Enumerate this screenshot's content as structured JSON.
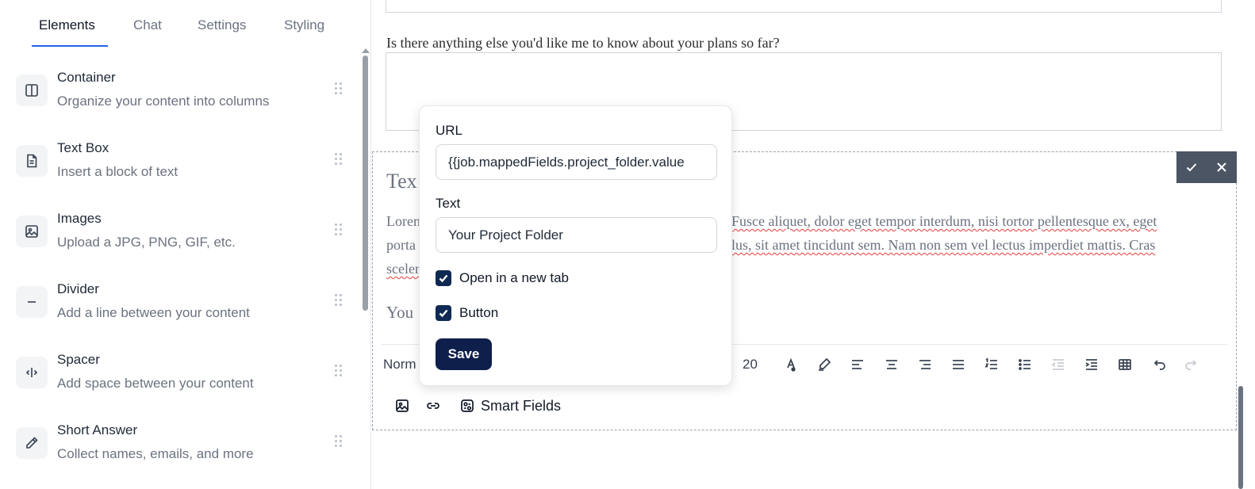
{
  "tabs": [
    {
      "label": "Elements",
      "active": true
    },
    {
      "label": "Chat",
      "active": false
    },
    {
      "label": "Settings",
      "active": false
    },
    {
      "label": "Styling",
      "active": false
    }
  ],
  "elements": [
    {
      "title": "Container",
      "desc": "Organize your content into columns",
      "icon": "columns-icon"
    },
    {
      "title": "Text Box",
      "desc": "Insert a block of text",
      "icon": "document-icon"
    },
    {
      "title": "Images",
      "desc": "Upload a JPG, PNG, GIF, etc.",
      "icon": "image-icon"
    },
    {
      "title": "Divider",
      "desc": "Add a line between your content",
      "icon": "minus-icon"
    },
    {
      "title": "Spacer",
      "desc": "Add space between your content",
      "icon": "spacer-icon"
    },
    {
      "title": "Short Answer",
      "desc": "Collect names, emails, and more",
      "icon": "pencil-icon"
    }
  ],
  "canvas": {
    "question": "Is there anything else you'd like me to know about your plans so far?",
    "heading_partial": "Tex",
    "para": {
      "l1a": "Loren",
      "l1b": "Fusce aliquet, dolor eget tempor interdum, nisi tortor pellentesque ex, eget",
      "l2a": "porta",
      "l2b": "lus, sit amet tincidunt sem. Nam non sem vel lectus imperdiet mattis. Cras",
      "l3a": "sceler"
    },
    "link_partial": "You"
  },
  "toolbar": {
    "style_label": "Norm",
    "font_size": "20",
    "smart_fields_label": "Smart Fields"
  },
  "popover": {
    "url_label": "URL",
    "url_value": "{{job.mappedFields.project_folder.value",
    "text_label": "Text",
    "text_value": "Your Project Folder",
    "open_new_tab_label": "Open in a new tab",
    "open_new_tab_checked": true,
    "button_label": "Button",
    "button_checked": true,
    "save_label": "Save"
  },
  "colors": {
    "accent": "#2563eb",
    "save_button": "#0f1f4b",
    "checkbox": "#0f2a52",
    "confirm_bar": "#4b5563"
  }
}
